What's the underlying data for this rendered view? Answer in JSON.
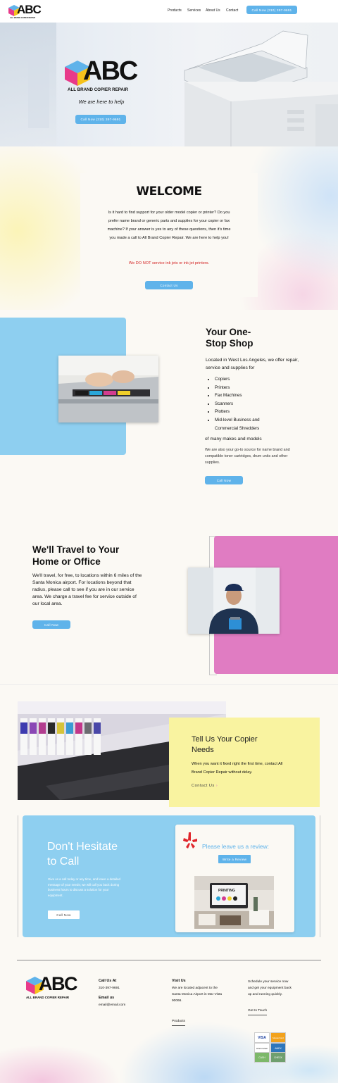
{
  "header": {
    "logo_text": "ABC",
    "logo_sub": "ALL BRAND COPIER REPAIR",
    "nav": [
      "Products",
      "Services",
      "About Us",
      "Contact"
    ],
    "call_button": "Call Now (310) 397-9691"
  },
  "hero": {
    "logo_text": "ABC",
    "logo_sub": "ALL BRAND COPIER REPAIR",
    "tagline": "We are here to help",
    "call_button": "Call Now (310) 397-9691"
  },
  "welcome": {
    "title": "WELCOME",
    "body": "Is it hard to find support for your older model copier or printer? Do you prefer name brand or generic parts and supplies for your copier or fax machine? If your answer is yes to any of these questions, then it's time you made a call to All Brand Copier Repair. We are here to help you!",
    "warning": "We DO NOT service ink jets or ink jet printers.",
    "button": "Contact Us"
  },
  "one_stop": {
    "title_line1": "Your One-",
    "title_line2": "Stop Shop",
    "intro": "Located in West Los Angeles, we offer repair, service and supplies for",
    "items": [
      "Copiers",
      "Printers",
      "Fax Machines",
      "Scanners",
      "Plotters",
      "Mid-level Business and Commercial Shredders"
    ],
    "makes": "of many makes and models",
    "note": "We are also your go-to source for name brand and compatible toner cartridges, drum units and other supplies.",
    "button": "Call Now"
  },
  "travel": {
    "title_line1": "We'll Travel to Your",
    "title_line2": "Home or Office",
    "body": "We'll travel, for free, to locations within 6 miles of the Santa Monica airport. For locations beyond that radius, please call to see if you are in our service area. We charge a travel fee for service outside of our local area.",
    "button": "Call Now"
  },
  "tell_us": {
    "title_line1": "Tell Us Your Copier",
    "title_line2": "Needs",
    "body": "When you want it fixed right the first time, contact All Brand Copier Repair without delay.",
    "link": "Contact Us",
    "link_arrow": "›"
  },
  "dont_hesitate": {
    "title_line1": "Don't Hesitate",
    "title_line2": "to Call",
    "body": "Give us a call today or any time, and leave a detailed message of your needs; we will call you back during business hours to discuss a solution for your equipment.",
    "button": "Call Now"
  },
  "review": {
    "title": "Please leave us a review:",
    "button": "Write a Review",
    "image_text": "PRINTING"
  },
  "footer": {
    "logo_text": "ABC",
    "logo_sub": "ALL BRAND COPIER REPAIR",
    "call_heading": "Call Us At",
    "phone": "310-397-9691",
    "email_heading": "Email us",
    "email": "email@email.com",
    "visit_heading": "Visit Us",
    "address": "We are located adjacent to the Santa Monica Airport in Mar Vista 90066.",
    "products_link": "Products",
    "schedule": "Schedule your service now and get your equipment back up and running quickly.",
    "get_in_touch": "Get In Touch",
    "payment_labels": [
      "VISA",
      "MasterCard",
      "DISCOVER",
      "AMEX",
      "CASH",
      "CHECK"
    ]
  },
  "colors": {
    "accent_blue": "#5fb3ea",
    "panel_blue": "#8ecff0",
    "pink": "#e07cc2",
    "yellow": "#f9f3a0",
    "warning_red": "#d21f1f"
  }
}
